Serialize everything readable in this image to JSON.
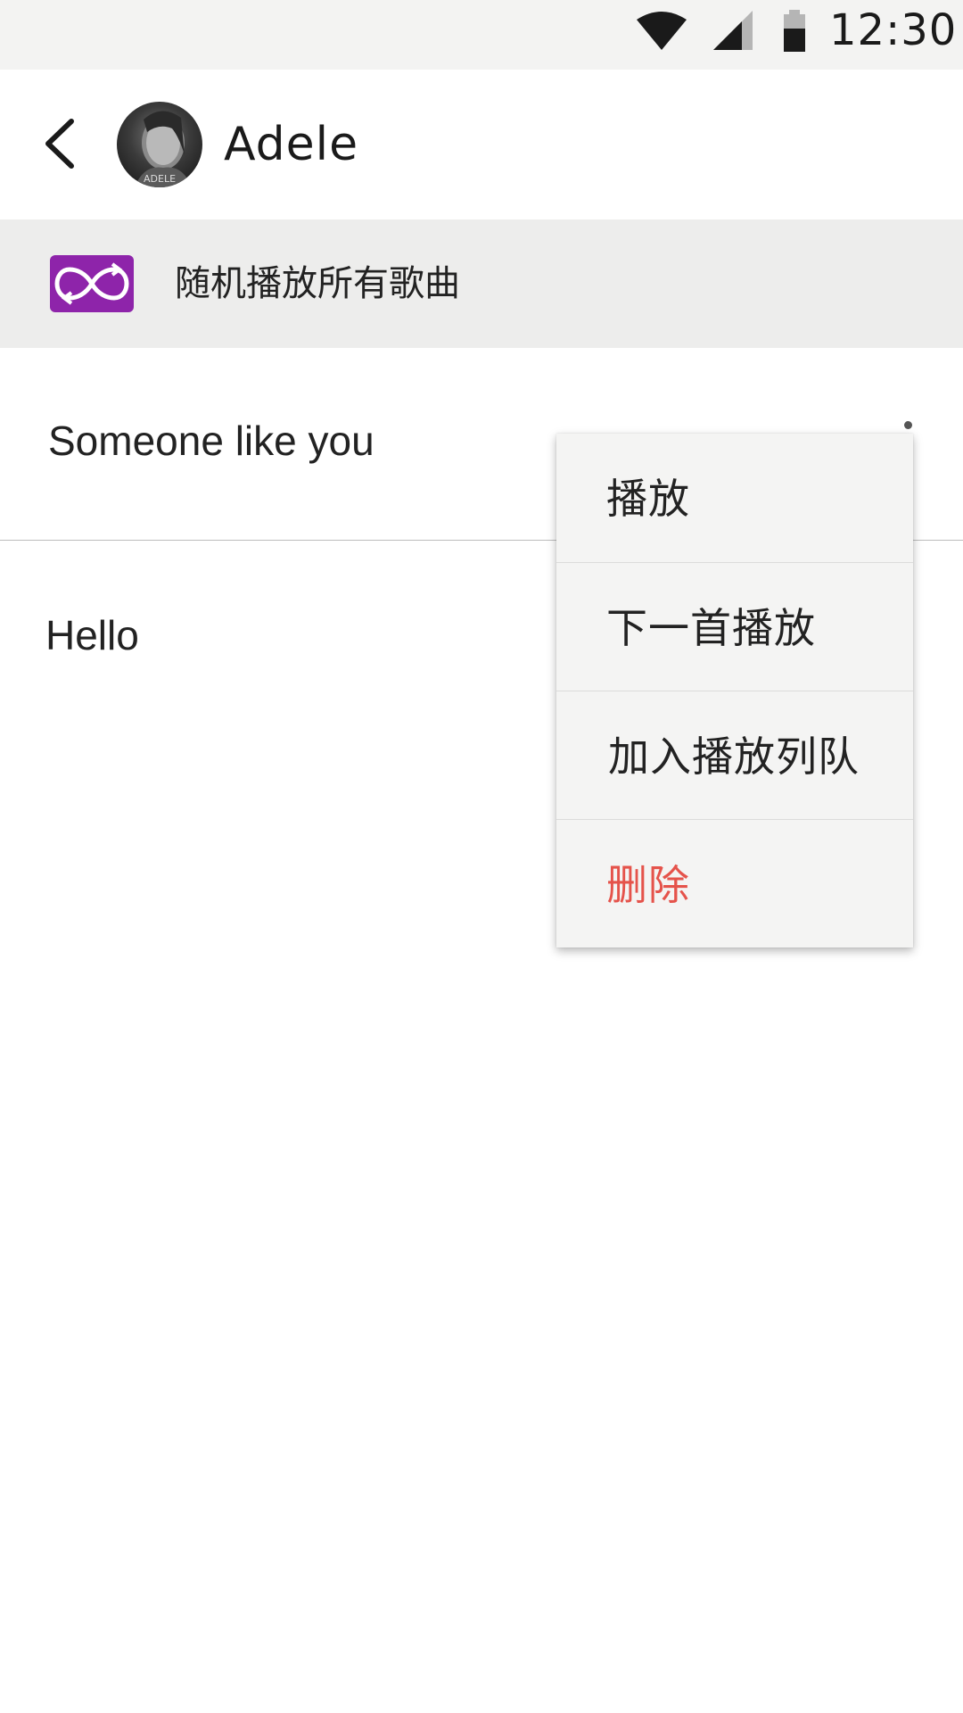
{
  "status_bar": {
    "time": "12:30",
    "icons": [
      "wifi-icon",
      "signal-icon",
      "battery-icon"
    ]
  },
  "header": {
    "back_icon": "back-arrow-icon",
    "avatar_alt": "ADELE",
    "title": "Adele"
  },
  "shuffle": {
    "icon": "shuffle-infinity-icon",
    "label": "随机播放所有歌曲",
    "accent": "#8e24aa"
  },
  "songs": [
    {
      "title": "Someone like you"
    },
    {
      "title": "Hello"
    }
  ],
  "context_menu": {
    "items": [
      {
        "label": "播放"
      },
      {
        "label": "下一首播放"
      },
      {
        "label": "加入播放列队"
      },
      {
        "label": "删除",
        "color": "#e5534b"
      }
    ]
  }
}
